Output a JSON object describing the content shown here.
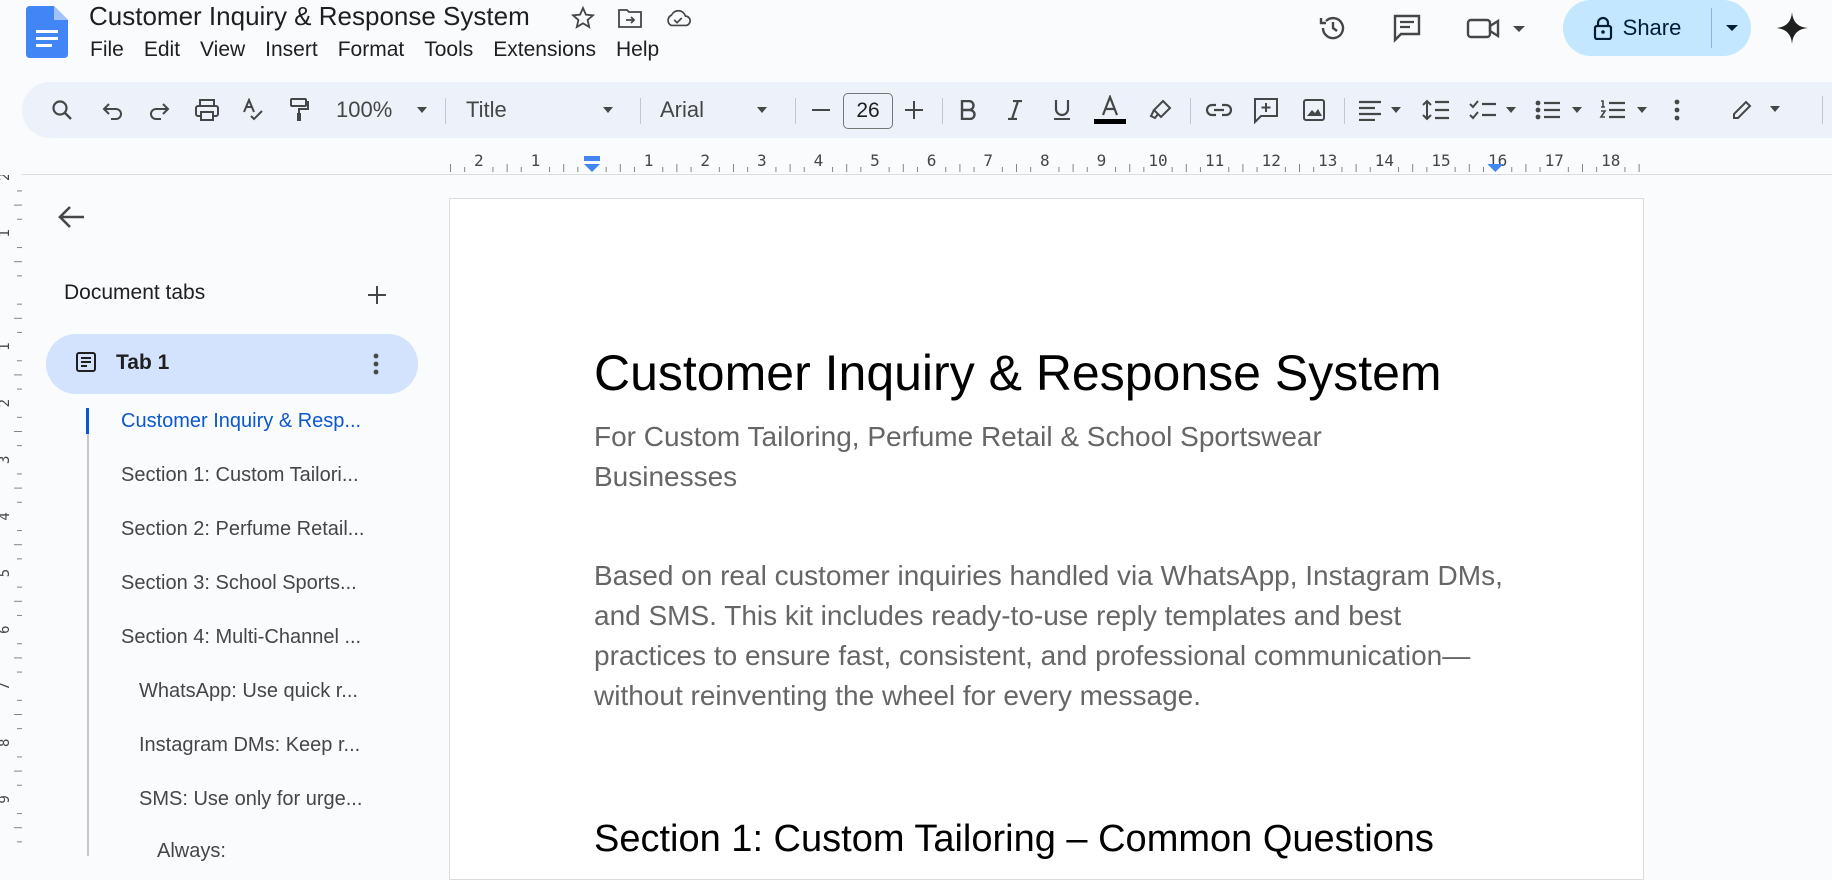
{
  "app": {
    "doc_title": "Customer Inquiry & Response System",
    "menu": [
      "File",
      "Edit",
      "View",
      "Insert",
      "Format",
      "Tools",
      "Extensions",
      "Help"
    ],
    "share_label": "Share"
  },
  "toolbar": {
    "zoom": "100%",
    "style": "Title",
    "font": "Arial",
    "font_size": "26"
  },
  "ruler": {
    "h_labels": [
      "2",
      "1",
      "1",
      "2",
      "3",
      "4",
      "5",
      "6",
      "7",
      "8",
      "9",
      "10",
      "11",
      "12",
      "13",
      "14",
      "15",
      "16",
      "17",
      "18"
    ],
    "v_labels": [
      "2",
      "1",
      "1",
      "2",
      "3",
      "4",
      "5",
      "6",
      "7",
      "8",
      "9"
    ]
  },
  "sidebar": {
    "heading": "Document tabs",
    "tab_label": "Tab 1",
    "outline": [
      "Customer Inquiry & Resp...",
      "Section 1: Custom Tailori...",
      "Section 2: Perfume Retail...",
      "Section 3: School Sports...",
      "Section 4: Multi-Channel ...",
      "WhatsApp: Use quick r...",
      "Instagram DMs: Keep r...",
      "SMS: Use only for urge...",
      "Always:"
    ]
  },
  "document": {
    "title": "Customer Inquiry & Response System",
    "subtitle": "For Custom Tailoring, Perfume Retail & School Sportswear Businesses",
    "intro": "Based on real customer inquiries handled via WhatsApp, Instagram DMs, and SMS. This kit includes ready-to-use reply templates and best practices to ensure fast, consistent, and professional communication—without reinventing the wheel for every message.",
    "section1": "Section 1: Custom Tailoring – Common Questions"
  },
  "colors": {
    "accent": "#0b57d0",
    "share_bg": "#c2e7ff",
    "toolbar_bg": "#edf2fa",
    "tab_selected": "#d3e3fd"
  }
}
